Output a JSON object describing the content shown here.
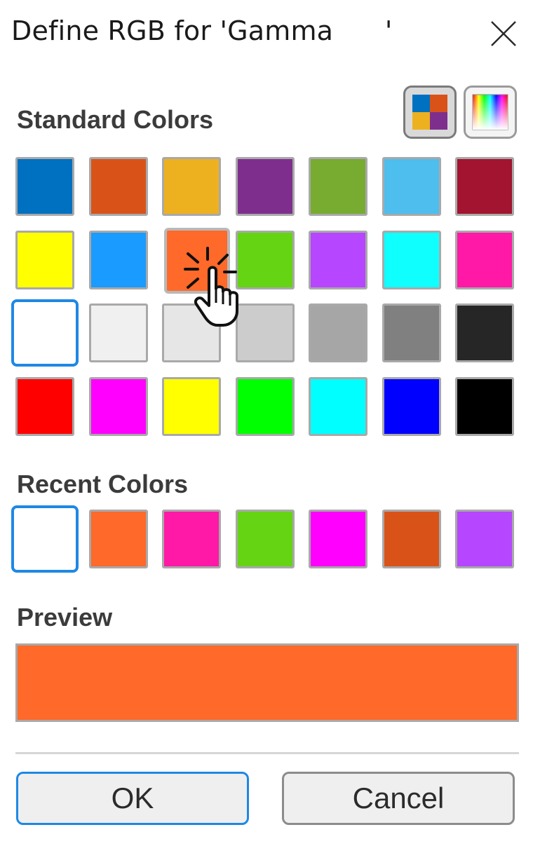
{
  "dialog": {
    "title": "Define RGB for 'Gamma      '",
    "close_icon": "close-icon"
  },
  "standard": {
    "label": "Standard Colors",
    "mode_buttons": [
      {
        "name": "palette-mode-icon",
        "active": true
      },
      {
        "name": "spectrum-mode-icon",
        "active": false
      }
    ],
    "rows": [
      [
        "#0070C0",
        "#D95319",
        "#EDB120",
        "#7E2F8E",
        "#77AC30",
        "#4DBEEE",
        "#A2142F"
      ],
      [
        "#FFFF00",
        "#1A9BFF",
        "#FF6929",
        "#64D413",
        "#B646FF",
        "#0FFFFF",
        "#FF19A6"
      ],
      [
        "#FFFFFF",
        "#F0F0F0",
        "#E6E6E6",
        "#CCCCCC",
        "#A6A6A6",
        "#808080",
        "#262626"
      ],
      [
        "#FF0000",
        "#FF00FF",
        "#FFFF00",
        "#00FF00",
        "#00FFFF",
        "#0000FF",
        "#000000"
      ]
    ],
    "selected_index": [
      2,
      0
    ],
    "hovered_index": [
      1,
      2
    ]
  },
  "recent": {
    "label": "Recent Colors",
    "colors": [
      "#FFFFFF",
      "#FF6929",
      "#FF19A6",
      "#64D413",
      "#FF00FF",
      "#D95319",
      "#B646FF"
    ],
    "selected_index": 0
  },
  "preview": {
    "label": "Preview",
    "color": "#FF6929"
  },
  "buttons": {
    "ok_label": "OK",
    "cancel_label": "Cancel"
  },
  "colors": {
    "accent": "#1E88E5",
    "swatch_border": "#A9A9A9"
  }
}
